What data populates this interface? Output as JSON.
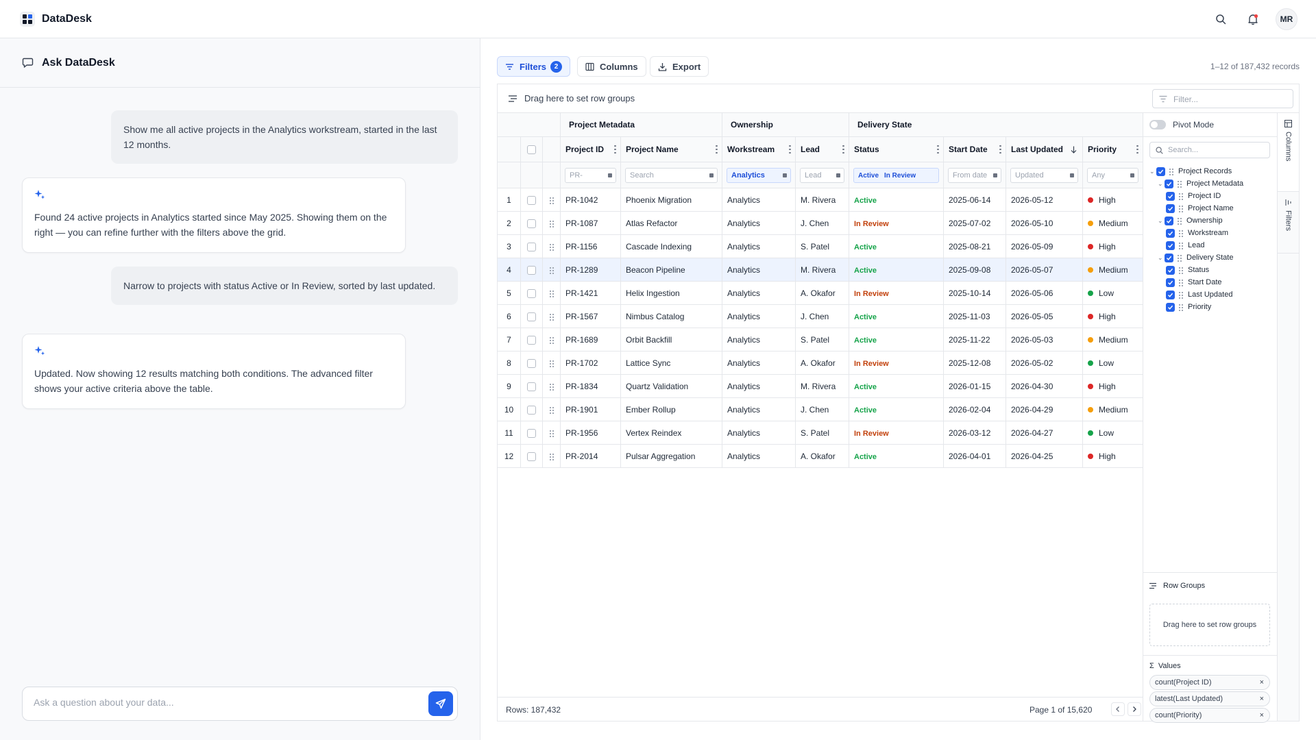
{
  "app": {
    "name": "DataDesk",
    "user_initials": "MR"
  },
  "chat": {
    "title": "Ask DataDesk",
    "messages": [
      {
        "role": "user",
        "text": "Show me all active projects in the Analytics workstream, started in the last 12 months."
      },
      {
        "role": "assistant",
        "text": "Found 24 active projects in Analytics started since May 2025. Showing them on the right — you can refine further with the filters above the grid."
      },
      {
        "role": "user",
        "text": "Narrow to projects with status Active or In Review, sorted by last updated."
      },
      {
        "role": "assistant",
        "text": "Updated. Now showing 12 results matching both conditions. The advanced filter shows your active criteria above the table."
      }
    ],
    "input_placeholder": "Ask a question about your data..."
  },
  "toolbar": {
    "filters_label": "Filters",
    "filters_count": "2",
    "columns_label": "Columns",
    "export_label": "Export",
    "records_text": "1–12 of 187,432 records"
  },
  "grid": {
    "group_bar_text": "Drag here to set row groups",
    "quick_filter_placeholder": "Filter...",
    "column_groups": {
      "metadata": "Project Metadata",
      "ownership": "Ownership",
      "delivery": "Delivery State"
    },
    "columns": {
      "id": "Project ID",
      "name": "Project Name",
      "workstream": "Workstream",
      "lead": "Lead",
      "status": "Status",
      "start": "Start Date",
      "updated": "Last Updated",
      "priority": "Priority"
    },
    "floating_filters": {
      "id": "PR-",
      "name": "Search",
      "workstream": "Analytics",
      "lead": "Lead",
      "status": [
        "Active",
        "In Review"
      ],
      "start": "From date",
      "updated": "Updated",
      "priority": "Any"
    },
    "rows": [
      {
        "n": "1",
        "id": "PR-1042",
        "name": "Phoenix Migration",
        "workstream": "Analytics",
        "lead": "M. Rivera",
        "status": "Active",
        "start": "2025-06-14",
        "updated": "2026-05-12",
        "priority": "High"
      },
      {
        "n": "2",
        "id": "PR-1087",
        "name": "Atlas Refactor",
        "workstream": "Analytics",
        "lead": "J. Chen",
        "status": "In Review",
        "start": "2025-07-02",
        "updated": "2026-05-10",
        "priority": "Medium"
      },
      {
        "n": "3",
        "id": "PR-1156",
        "name": "Cascade Indexing",
        "workstream": "Analytics",
        "lead": "S. Patel",
        "status": "Active",
        "start": "2025-08-21",
        "updated": "2026-05-09",
        "priority": "High"
      },
      {
        "n": "4",
        "id": "PR-1289",
        "name": "Beacon Pipeline",
        "workstream": "Analytics",
        "lead": "M. Rivera",
        "status": "Active",
        "start": "2025-09-08",
        "updated": "2026-05-07",
        "priority": "Medium"
      },
      {
        "n": "5",
        "id": "PR-1421",
        "name": "Helix Ingestion",
        "workstream": "Analytics",
        "lead": "A. Okafor",
        "status": "In Review",
        "start": "2025-10-14",
        "updated": "2026-05-06",
        "priority": "Low"
      },
      {
        "n": "6",
        "id": "PR-1567",
        "name": "Nimbus Catalog",
        "workstream": "Analytics",
        "lead": "J. Chen",
        "status": "Active",
        "start": "2025-11-03",
        "updated": "2026-05-05",
        "priority": "High"
      },
      {
        "n": "7",
        "id": "PR-1689",
        "name": "Orbit Backfill",
        "workstream": "Analytics",
        "lead": "S. Patel",
        "status": "Active",
        "start": "2025-11-22",
        "updated": "2026-05-03",
        "priority": "Medium"
      },
      {
        "n": "8",
        "id": "PR-1702",
        "name": "Lattice Sync",
        "workstream": "Analytics",
        "lead": "A. Okafor",
        "status": "In Review",
        "start": "2025-12-08",
        "updated": "2026-05-02",
        "priority": "Low"
      },
      {
        "n": "9",
        "id": "PR-1834",
        "name": "Quartz Validation",
        "workstream": "Analytics",
        "lead": "M. Rivera",
        "status": "Active",
        "start": "2026-01-15",
        "updated": "2026-04-30",
        "priority": "High"
      },
      {
        "n": "10",
        "id": "PR-1901",
        "name": "Ember Rollup",
        "workstream": "Analytics",
        "lead": "J. Chen",
        "status": "Active",
        "start": "2026-02-04",
        "updated": "2026-04-29",
        "priority": "Medium"
      },
      {
        "n": "11",
        "id": "PR-1956",
        "name": "Vertex Reindex",
        "workstream": "Analytics",
        "lead": "S. Patel",
        "status": "In Review",
        "start": "2026-03-12",
        "updated": "2026-04-27",
        "priority": "Low"
      },
      {
        "n": "12",
        "id": "PR-2014",
        "name": "Pulsar Aggregation",
        "workstream": "Analytics",
        "lead": "A. Okafor",
        "status": "Active",
        "start": "2026-04-01",
        "updated": "2026-04-25",
        "priority": "High"
      }
    ],
    "footer_rows": "Rows: 187,432",
    "footer_page": "Page 1 of 15,620"
  },
  "side_panel": {
    "pivot_label": "Pivot Mode",
    "search_placeholder": "Search...",
    "tree": [
      {
        "label": "Project Records",
        "level": 0,
        "group": true
      },
      {
        "label": "Project Metadata",
        "level": 1,
        "group": true
      },
      {
        "label": "Project ID",
        "level": 2,
        "group": false
      },
      {
        "label": "Project Name",
        "level": 2,
        "group": false
      },
      {
        "label": "Ownership",
        "level": 1,
        "group": true
      },
      {
        "label": "Workstream",
        "level": 2,
        "group": false
      },
      {
        "label": "Lead",
        "level": 2,
        "group": false
      },
      {
        "label": "Delivery State",
        "level": 1,
        "group": true
      },
      {
        "label": "Status",
        "level": 2,
        "group": false
      },
      {
        "label": "Start Date",
        "level": 2,
        "group": false
      },
      {
        "label": "Last Updated",
        "level": 2,
        "group": false
      },
      {
        "label": "Priority",
        "level": 2,
        "group": false
      }
    ],
    "row_groups_label": "Row Groups",
    "row_groups_drop": "Drag here to set row groups",
    "values_label": "Values",
    "values": [
      "count(Project ID)",
      "latest(Last Updated)",
      "count(Priority)"
    ],
    "tabs": [
      "Columns",
      "Filters"
    ]
  },
  "colors": {
    "accent": "#2563eb",
    "active": "#16a34a",
    "in_review": "#c2410c",
    "high": "#dc2626",
    "medium": "#f59e0b",
    "low": "#16a34a"
  }
}
